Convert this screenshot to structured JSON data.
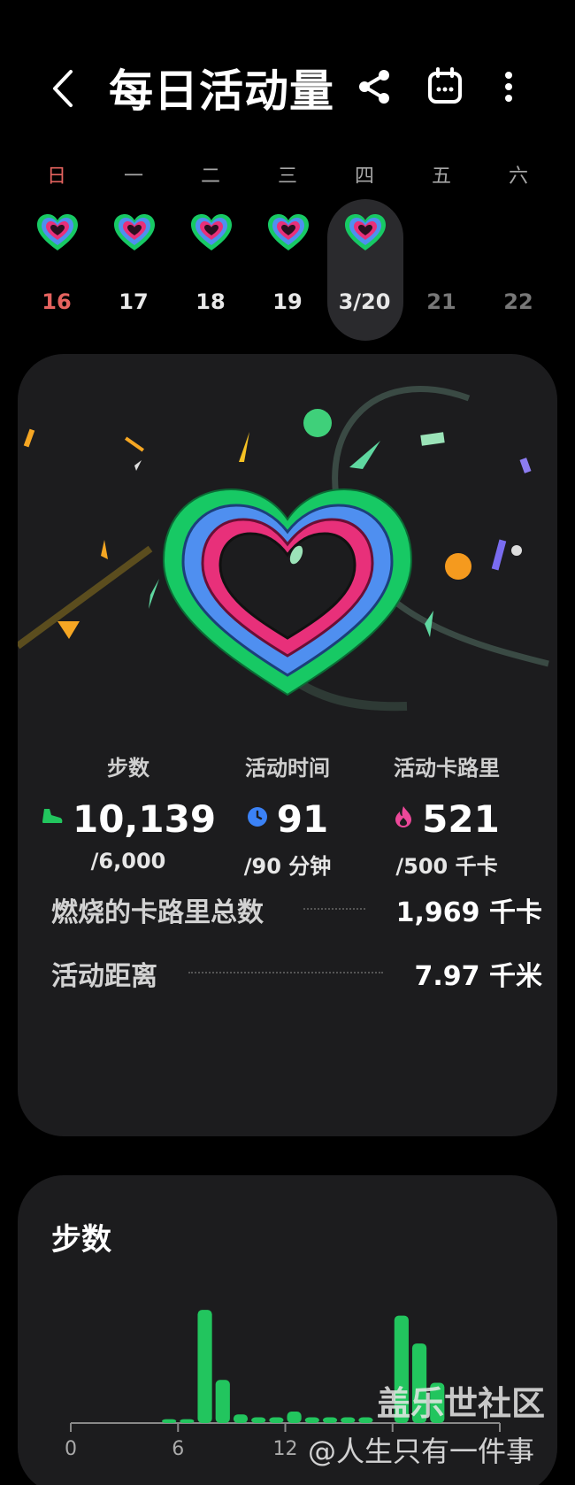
{
  "header": {
    "title": "每日活动量",
    "icons": [
      "back-arrow-icon",
      "share-icon",
      "calendar-icon",
      "more-vertical-icon"
    ]
  },
  "week": {
    "days": [
      {
        "name": "日",
        "date": "16"
      },
      {
        "name": "一",
        "date": "17"
      },
      {
        "name": "二",
        "date": "18"
      },
      {
        "name": "三",
        "date": "19"
      },
      {
        "name": "四",
        "date": "3/20"
      },
      {
        "name": "五",
        "date": "21"
      },
      {
        "name": "六",
        "date": "22"
      }
    ],
    "selected_index": 4
  },
  "summary": {
    "steps": {
      "label": "步数",
      "value": "10,139",
      "goal": "/6,000"
    },
    "active_time": {
      "label": "活动时间",
      "value": "91",
      "goal": "/90 分钟"
    },
    "calories": {
      "label": "活动卡路里",
      "value": "521",
      "goal": "/500 千卡"
    },
    "total_burned": {
      "label": "燃烧的卡路里总数",
      "value": "1,969 千卡"
    },
    "distance": {
      "label": "活动距离",
      "value": "7.97 千米"
    }
  },
  "colors": {
    "steps": "#22c55e",
    "active_time": "#3b82f6",
    "calories": "#ec4899",
    "ring_green": "#17c964",
    "ring_blue": "#4f8ff0",
    "ring_pink": "#e8307a"
  },
  "steps_chart": {
    "title": "步数",
    "x_labels": [
      "0",
      "6",
      "12"
    ]
  },
  "chart_data": {
    "type": "bar",
    "title": "步数",
    "x_ticks": [
      0,
      6,
      12,
      18,
      24
    ],
    "x_tick_labels": [
      "0",
      "6",
      "12"
    ],
    "hours": [
      0,
      1,
      2,
      3,
      4,
      5,
      6,
      7,
      8,
      9,
      10,
      11,
      12,
      13,
      14,
      15,
      16,
      17,
      18,
      19,
      20,
      21,
      22,
      23
    ],
    "values": [
      0,
      0,
      0,
      0,
      0,
      40,
      40,
      1180,
      450,
      90,
      60,
      60,
      120,
      60,
      60,
      60,
      60,
      0,
      1120,
      830,
      420,
      0,
      0,
      0
    ],
    "ylim": [
      0,
      1200
    ],
    "color": "#22c55e"
  },
  "watermark": {
    "line1": "盖乐世社区",
    "line2": "@人生只有一件事"
  }
}
